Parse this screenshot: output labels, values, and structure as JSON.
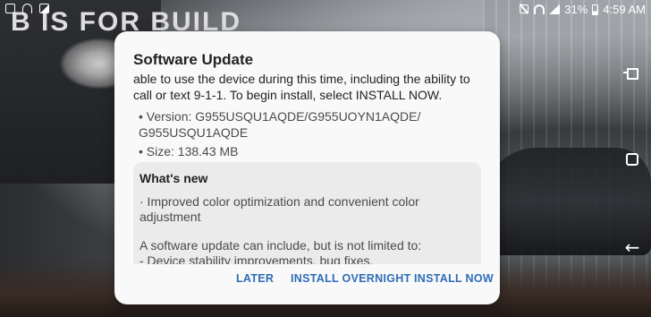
{
  "status_bar": {
    "battery_percent": "31%",
    "time": "4:59 AM",
    "left_icons": [
      "checkbox-icon",
      "wifi-calling-icon",
      "gallery-icon"
    ],
    "right_icons": [
      "mute-icon",
      "wifi-icon",
      "signal-icon",
      "battery-icon"
    ]
  },
  "background": {
    "banner_text": "B IS FOR BUILD"
  },
  "dialog": {
    "title": "Software Update",
    "intro_lines": [
      "able to use the device during this time, including the ability to",
      "call or text 9-1-1. To begin install, select INSTALL NOW."
    ],
    "version_line1": "• Version: G955USQU1AQDE/G955UOYN1AQDE/",
    "version_line2": "G955USQU1AQDE",
    "size_line": "• Size: 138.43 MB",
    "whats_new": {
      "title": "What's new",
      "lines": [
        "· Improved color optimization and convenient color",
        "adjustment",
        "A software update can include, but is not limited to:",
        " - Device stability improvements, bug fixes."
      ]
    },
    "actions": {
      "later": "LATER",
      "install_overnight": "INSTALL OVERNIGHT",
      "install_now": "INSTALL NOW"
    }
  },
  "colors": {
    "accent": "#2f6cb8",
    "dialog_bg": "#f9f9f9",
    "whats_new_bg": "#ebebeb"
  },
  "nav_icons": [
    "recents-icon",
    "home-icon",
    "back-icon"
  ]
}
